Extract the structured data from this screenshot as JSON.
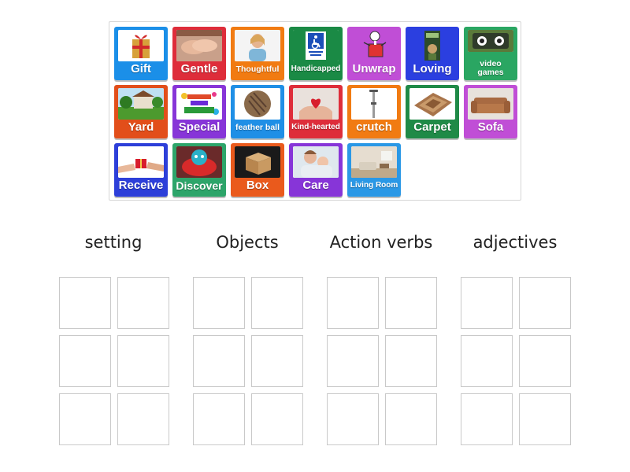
{
  "cards": [
    {
      "label": "Gift",
      "color": "#1b8fe8",
      "icon": "gift-image"
    },
    {
      "label": "Gentle",
      "color": "#de2d3a",
      "icon": "holding-hands-image"
    },
    {
      "label": "Thoughtful",
      "color": "#f17b12",
      "icon": "thinking-woman-image"
    },
    {
      "label": "Handicapped",
      "color": "#1a8a45",
      "icon": "handicapped-parking-sign-image"
    },
    {
      "label": "Unwrap",
      "color": "#c04ed6",
      "icon": "unwrap-present-image"
    },
    {
      "label": "Loving",
      "color": "#2b3fe0",
      "icon": "loving-book-image"
    },
    {
      "label": "video games",
      "color": "#2aa662",
      "icon": "video-game-controller-image"
    },
    {
      "label": "Yard",
      "color": "#e24e1a",
      "icon": "yard-house-image"
    },
    {
      "label": "Special",
      "color": "#8735d8",
      "icon": "you-are-special-image"
    },
    {
      "label": "feather ball",
      "color": "#1f8fe6",
      "icon": "feather-ball-image"
    },
    {
      "label": "Kind-hearted",
      "color": "#de2d3a",
      "icon": "heart-hands-image"
    },
    {
      "label": "crutch",
      "color": "#f17b12",
      "icon": "crutch-image"
    },
    {
      "label": "Carpet",
      "color": "#1f8a47",
      "icon": "carpet-image"
    },
    {
      "label": "Sofa",
      "color": "#c04ed6",
      "icon": "sofa-image"
    },
    {
      "label": "Receive",
      "color": "#2d3fd9",
      "icon": "receive-gift-image"
    },
    {
      "label": "Discover",
      "color": "#2da56a",
      "icon": "robot-toy-image"
    },
    {
      "label": "Box",
      "color": "#ea5a1c",
      "icon": "cardboard-box-image"
    },
    {
      "label": "Care",
      "color": "#8735d8",
      "icon": "care-child-image"
    },
    {
      "label": "Living Room",
      "color": "#2a98e6",
      "icon": "living-room-image"
    }
  ],
  "groups": [
    {
      "title": "setting"
    },
    {
      "title": "Objects"
    },
    {
      "title": "Action verbs"
    },
    {
      "title": "adjectives"
    }
  ]
}
